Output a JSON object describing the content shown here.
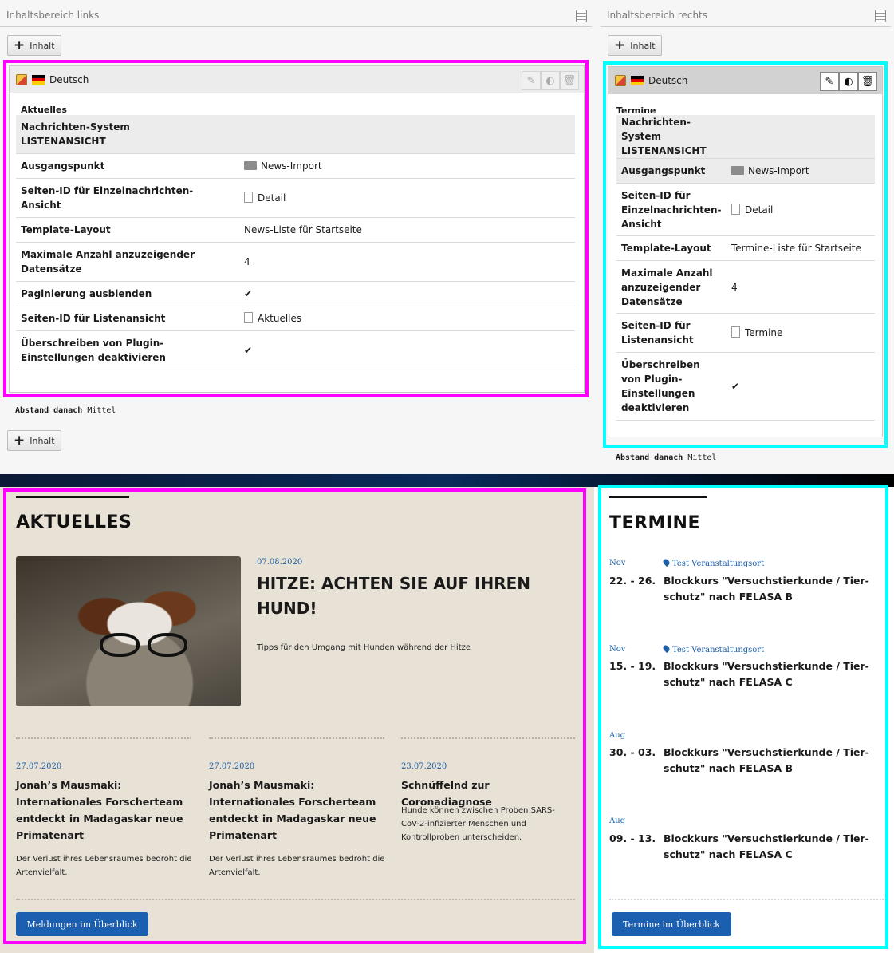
{
  "backend": {
    "left": {
      "header": "Inhaltsbereich links",
      "add_label": "Inhalt",
      "language": "Deutsch",
      "ctype": "Aktuelles",
      "rows": [
        {
          "key": "Nachrichten-System\nLISTENANSICHT",
          "value": ""
        },
        {
          "key": "Ausgangspunkt",
          "value": "News-Import"
        },
        {
          "key": "Seiten-ID für Einzelnachrichten-\nAnsicht",
          "value": "Detail"
        },
        {
          "key": "Template-Layout",
          "value": "News-Liste für Startseite"
        },
        {
          "key": "Maximale Anzahl anzuzeigender\nDatensätze",
          "value": "4"
        },
        {
          "key": "Paginierung ausblenden",
          "value": "✔"
        },
        {
          "key": "Seiten-ID für Listenansicht",
          "value": "Aktuelles"
        },
        {
          "key": "Überschreiben von Plugin-\nEinstellungen deaktivieren",
          "value": "✔"
        }
      ],
      "spacing_key": "Abstand danach",
      "spacing_value": "Mittel"
    },
    "right": {
      "header": "Inhaltsbereich rechts",
      "add_label": "Inhalt",
      "language": "Deutsch",
      "ctype": "Termine",
      "rows": [
        {
          "key": "Nachrichten-System\nLISTENANSICHT",
          "value": ""
        },
        {
          "key": "Ausgangspunkt",
          "value": "News-Import"
        },
        {
          "key": "Seiten-ID für\nEinzelnachrichten-\nAnsicht",
          "value": "Detail"
        },
        {
          "key": "Template-Layout",
          "value": "Termine-Liste für Startseite"
        },
        {
          "key": "Maximale Anzahl\nanzuzeigender\nDatensätze",
          "value": "4"
        },
        {
          "key": "Seiten-ID für\nListenansicht",
          "value": "Termine"
        },
        {
          "key": "Überschreiben\nvon Plugin-\nEinstellungen\ndeaktivieren",
          "value": "✔"
        }
      ],
      "spacing_key": "Abstand danach",
      "spacing_value": "Mittel"
    }
  },
  "frontend": {
    "news": {
      "title": "AKTUELLES",
      "lead": {
        "date": "07.08.2020",
        "title": "HITZE: ACHTEN SIE AUF IHREN HUND!",
        "teaser": "Tipps für den Umgang mit Hunden während der Hitze"
      },
      "items": [
        {
          "date": "27.07.2020",
          "title": "Jonah’s Mausmaki: Internationales Forscherteam entdeckt in Madagaskar neue Primatenart",
          "teaser": "Der Verlust ihres Lebensraumes bedroht die Artenvielfalt."
        },
        {
          "date": "27.07.2020",
          "title": "Jonah’s Mausmaki: Internationales Forscherteam entdeckt in Madagaskar neue Primatenart",
          "teaser": "Der Verlust ihres Lebensraumes bedroht die Artenvielfalt."
        },
        {
          "date": "23.07.2020",
          "title": "Schnüffelnd zur Coronadiagnose",
          "teaser": "Hunde können zwischen Proben SARS-CoV-2-infizierter Menschen und Kontrollproben unterscheiden."
        }
      ],
      "button": "Meldungen im Überblick"
    },
    "events": {
      "title": "TERMINE",
      "items": [
        {
          "month": "Nov",
          "location": "Test Veranstaltungsort",
          "dates": "22. - 26.",
          "title": "Blockkurs \"Versuchstierkunde / Tier-schutz\" nach FELASA B"
        },
        {
          "month": "Nov",
          "location": "Test Veranstaltungsort",
          "dates": "15. - 19.",
          "title": "Blockkurs \"Versuchstierkunde / Tier-schutz\" nach FELASA C"
        },
        {
          "month": "Aug",
          "location": "",
          "dates": "30. - 03.",
          "title": "Blockkurs \"Versuchstierkunde / Tier-schutz\" nach FELASA B"
        },
        {
          "month": "Aug",
          "location": "",
          "dates": "09. - 13.",
          "title": "Blockkurs \"Versuchstierkunde / Tier-schutz\" nach FELASA C"
        }
      ],
      "button": "Termine im Überblick"
    }
  },
  "colors": {
    "magenta": "#ff00ff",
    "cyan": "#00ffff",
    "link_blue": "#1a5fa8",
    "button_blue": "#1a5fb0",
    "news_bg": "#e8e1d6"
  }
}
